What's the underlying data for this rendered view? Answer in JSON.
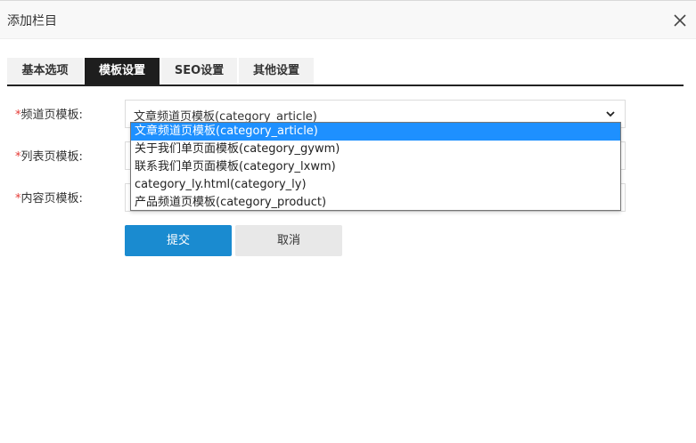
{
  "dialog": {
    "title": "添加栏目"
  },
  "tabs": [
    {
      "label": "基本选项",
      "active": false
    },
    {
      "label": "模板设置",
      "active": true
    },
    {
      "label": "SEO设置",
      "active": false
    },
    {
      "label": "其他设置",
      "active": false
    }
  ],
  "form": {
    "required_mark": "*",
    "fields": [
      {
        "label": "频道页模板:",
        "value": "文章频道页模板(category_article)"
      },
      {
        "label": "列表页模板:",
        "value": ""
      },
      {
        "label": "内容页模板:",
        "value": ""
      }
    ],
    "dropdown_options": [
      "文章频道页模板(category_article)",
      "关于我们单页面模板(category_gywm)",
      "联系我们单页面模板(category_lxwm)",
      "category_ly.html(category_ly)",
      "产品频道页模板(category_product)"
    ],
    "selected_index": 0,
    "submit_label": "提交",
    "cancel_label": "取消"
  },
  "colors": {
    "active_tab": "#1e1e1e",
    "submit_button": "#1a8bd0",
    "option_highlight": "#1e90ff",
    "required_mark": "#e53935"
  },
  "icons": {
    "close": "close-icon",
    "select_caret": "chevron-down-icon"
  }
}
